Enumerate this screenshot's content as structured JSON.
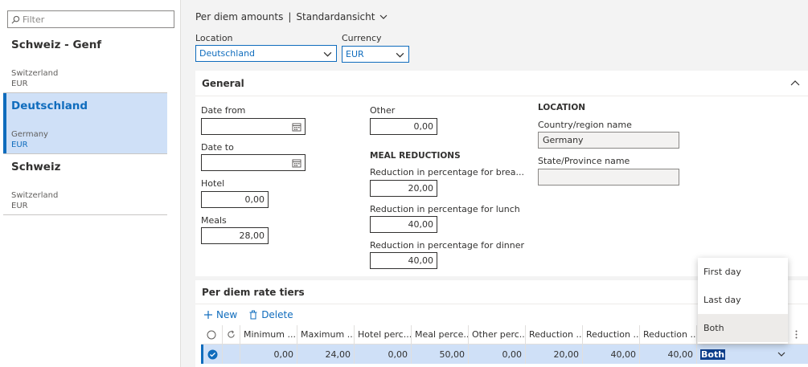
{
  "filter": {
    "placeholder": "Filter"
  },
  "list": [
    {
      "title": "Schweiz - Genf",
      "country": "Switzerland",
      "currency": "EUR"
    },
    {
      "title": "Deutschland",
      "country": "Germany",
      "currency": "EUR"
    },
    {
      "title": "Schweiz",
      "country": "Switzerland",
      "currency": "EUR"
    }
  ],
  "breadcrumb": {
    "page": "Per diem amounts",
    "separator": "|",
    "view": "Standardansicht"
  },
  "header_fields": {
    "location_label": "Location",
    "location_value": "Deutschland",
    "currency_label": "Currency",
    "currency_value": "EUR"
  },
  "general": {
    "title": "General",
    "date_from_label": "Date from",
    "date_to_label": "Date to",
    "hotel_label": "Hotel",
    "hotel_value": "0,00",
    "meals_label": "Meals",
    "meals_value": "28,00",
    "other_label": "Other",
    "other_value": "0,00",
    "meal_reductions_heading": "MEAL REDUCTIONS",
    "breakfast_label": "Reduction in percentage for brea...",
    "breakfast_value": "20,00",
    "lunch_label": "Reduction in percentage for lunch",
    "lunch_value": "40,00",
    "dinner_label": "Reduction in percentage for dinner",
    "dinner_value": "40,00",
    "location_heading": "LOCATION",
    "country_label": "Country/region name",
    "country_value": "Germany",
    "state_label": "State/Province name",
    "state_value": ""
  },
  "tiers": {
    "title": "Per diem rate tiers",
    "new_label": "New",
    "delete_label": "Delete",
    "columns": [
      "Minimum ...",
      "Maximum ...",
      "Hotel perc...",
      "Meal perce...",
      "Other perc...",
      "Reduction ...",
      "Reduction ...",
      "Reduction ..."
    ],
    "row": [
      "0,00",
      "24,00",
      "0,00",
      "50,00",
      "0,00",
      "20,00",
      "40,00",
      "40,00"
    ],
    "row_last": "Both"
  },
  "popup": {
    "options": [
      "First day",
      "Last day",
      "Both"
    ]
  },
  "colors": {
    "accent": "#0f6cbd",
    "selected_bg": "#cfe0f7"
  }
}
